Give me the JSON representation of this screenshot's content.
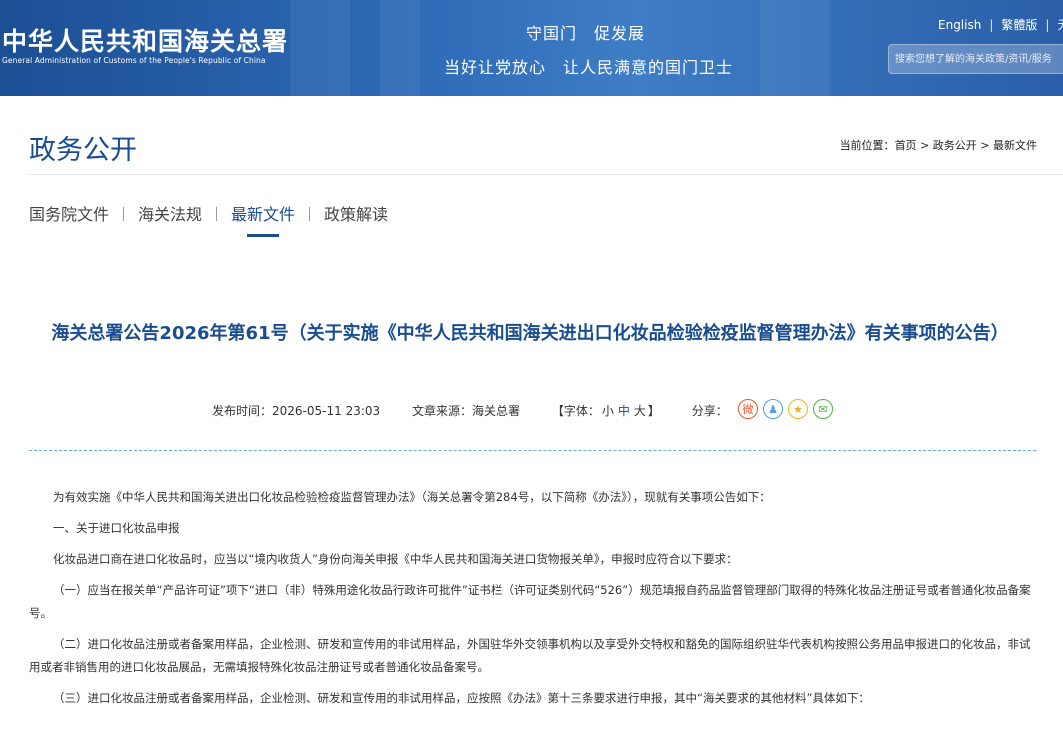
{
  "header": {
    "logo_cn": "中华人民共和国海关总署",
    "logo_en": "General Administration of Customs of the People's Republic of China",
    "slogan_line1": "守国门　促发展",
    "slogan_line2": "当好让党放心　让人民满意的国门卫士",
    "links": [
      "English",
      "繁體版",
      "无障"
    ],
    "search_placeholder": "搜索您想了解的海关政策/资讯/服务"
  },
  "section": {
    "title": "政务公开",
    "breadcrumb_prefix": "当前位置：",
    "breadcrumb": [
      "首页",
      "政务公开",
      "最新文件"
    ],
    "breadcrumb_sep": " > "
  },
  "tabs": [
    {
      "label": "国务院文件",
      "active": false
    },
    {
      "label": "海关法规",
      "active": false
    },
    {
      "label": "最新文件",
      "active": true
    },
    {
      "label": "政策解读",
      "active": false
    }
  ],
  "article": {
    "title": "海关总署公告2026年第61号（关于实施《中华人民共和国海关进出口化妆品检验检疫监督管理办法》有关事项的公告）",
    "publish_label": "发布时间：",
    "publish_time": "2026-05-11 23:03",
    "source_label": "文章来源：",
    "source": "海关总署",
    "font_label_open": "【字体：",
    "font_sizes": [
      "小",
      "中",
      "大"
    ],
    "font_label_close": "】",
    "share_label": "分享：",
    "share_icons": [
      "weibo-icon",
      "qq-icon",
      "qzone-icon",
      "wechat-icon"
    ],
    "paragraphs": [
      "为有效实施《中华人民共和国海关进出口化妆品检验检疫监督管理办法》（海关总署令第284号，以下简称《办法》），现就有关事项公告如下：",
      "一、关于进口化妆品申报",
      "化妆品进口商在进口化妆品时，应当以“境内收货人”身份向海关申报《中华人民共和国海关进口货物报关单》，申报时应符合以下要求：",
      "（一）应当在报关单“产品许可证”项下“进口（非）特殊用途化妆品行政许可批件”证书栏（许可证类别代码“526”）规范填报自药品监督管理部门取得的特殊化妆品注册证号或者普通化妆品备案号。",
      "（二）进口化妆品注册或者备案用样品，企业检测、研发和宣传用的非试用样品，外国驻华外交领事机构以及享受外交特权和豁免的国际组织驻华代表机构按照公务用品申报进口的化妆品，非试用或者非销售用的进口化妆品展品，无需填报特殊化妆品注册证号或者普通化妆品备案号。",
      "（三）进口化妆品注册或者备案用样品，企业检测、研发和宣传用的非试用样品，应按照《办法》第十三条要求进行申报，其中“海关要求的其他材料”具体如下："
    ]
  },
  "colors": {
    "brand_blue": "#1a4d8f",
    "header_blue": "#2f6bb8",
    "divider_teal": "#5fb4c9"
  }
}
